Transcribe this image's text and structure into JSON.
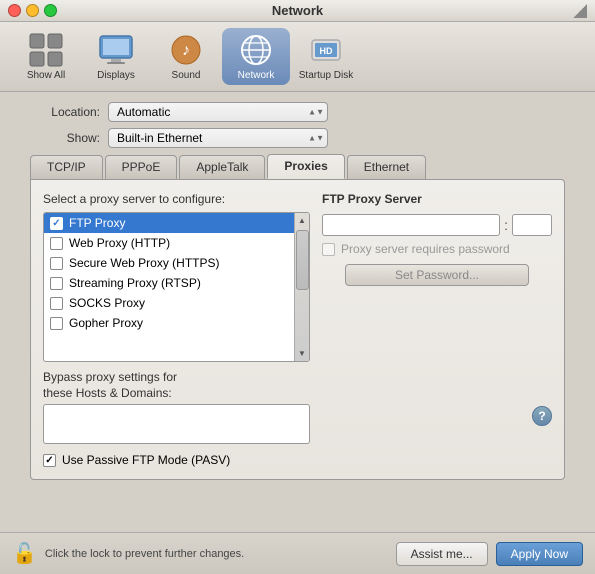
{
  "window": {
    "title": "Network"
  },
  "toolbar": {
    "items": [
      {
        "id": "show-all",
        "label": "Show All",
        "icon": "🔲"
      },
      {
        "id": "displays",
        "label": "Displays",
        "icon": "🖥"
      },
      {
        "id": "sound",
        "label": "Sound",
        "icon": "🔊"
      },
      {
        "id": "network",
        "label": "Network",
        "icon": "🌐",
        "active": true
      },
      {
        "id": "startup-disk",
        "label": "Startup Disk",
        "icon": "💿"
      }
    ]
  },
  "form": {
    "location_label": "Location:",
    "show_label": "Show:",
    "location_value": "Automatic",
    "show_value": "Built-in Ethernet"
  },
  "tabs": [
    {
      "id": "tcpip",
      "label": "TCP/IP"
    },
    {
      "id": "pppoe",
      "label": "PPPoE"
    },
    {
      "id": "appletalk",
      "label": "AppleTalk"
    },
    {
      "id": "proxies",
      "label": "Proxies",
      "active": true
    },
    {
      "id": "ethernet",
      "label": "Ethernet"
    }
  ],
  "proxies": {
    "section_title": "Select a proxy server to configure:",
    "items": [
      {
        "id": "ftp",
        "label": "FTP Proxy",
        "checked": true,
        "selected": true
      },
      {
        "id": "web",
        "label": "Web Proxy (HTTP)",
        "checked": false,
        "selected": false
      },
      {
        "id": "secure-web",
        "label": "Secure Web Proxy (HTTPS)",
        "checked": false,
        "selected": false
      },
      {
        "id": "streaming",
        "label": "Streaming Proxy (RTSP)",
        "checked": false,
        "selected": false
      },
      {
        "id": "socks",
        "label": "SOCKS Proxy",
        "checked": false,
        "selected": false
      },
      {
        "id": "gopher",
        "label": "Gopher Proxy",
        "checked": false,
        "selected": false
      }
    ]
  },
  "ftp_proxy": {
    "title": "FTP Proxy Server",
    "server_placeholder": "",
    "port_placeholder": "",
    "requires_password_label": "Proxy server requires password",
    "set_password_label": "Set Password..."
  },
  "bypass": {
    "label_line1": "Bypass proxy settings for",
    "label_line2": "these Hosts & Domains:",
    "value": ""
  },
  "pasv": {
    "label": "Use Passive FTP Mode (PASV)",
    "checked": true
  },
  "bottom": {
    "lock_label": "Click the lock to prevent further changes.",
    "assist_label": "Assist me...",
    "apply_label": "Apply Now"
  }
}
